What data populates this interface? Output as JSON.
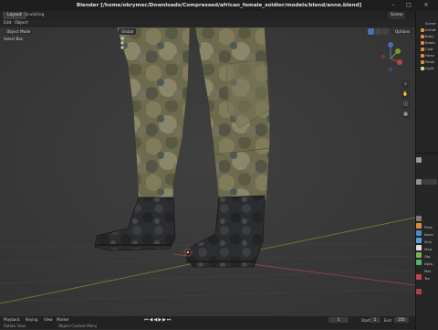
{
  "window": {
    "title": "Blender [/home/obrymec/Downloads/Compressed/african_female_soldier/models/blend/anne.blend]",
    "minimize": "–",
    "maximize": "□",
    "close": "✕"
  },
  "workspaces": [
    "Layout",
    "Sculpting"
  ],
  "scene_name": "Scene",
  "view_layer": "ViewLayer",
  "menu": [
    "Edit",
    "Object"
  ],
  "viewport_header": {
    "mode": "Object Mode",
    "select_box": "Select Box",
    "transform_orientation": "Global",
    "options": "Options"
  },
  "timeline": {
    "playback": "Playback",
    "keying": "Keying",
    "view": "View",
    "marker": "Marker",
    "current_frame": "1",
    "start_label": "Start",
    "start": "1",
    "end_label": "End",
    "end": "250"
  },
  "status": {
    "left": "Rotate View",
    "middle": "Object Context Menu"
  },
  "outliner": {
    "rows": [
      "Scene",
      "Armat",
      "Body",
      "Boots",
      "Coat",
      "Head",
      "Pants",
      "Light"
    ]
  },
  "properties": {
    "rows": [
      "Pose",
      "Bone",
      "Skin",
      "Mod",
      "Obj",
      "Data",
      "Mat",
      "Tex"
    ]
  },
  "colors": {
    "accent": "#4772b3",
    "x_axis": "#b5424f",
    "y_axis": "#7a9a2e",
    "z_axis": "#3f6fb0"
  }
}
